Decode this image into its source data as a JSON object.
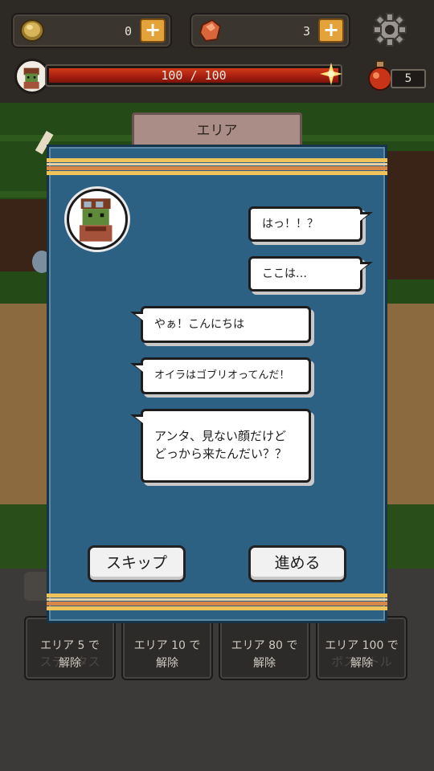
{
  "hud": {
    "coins": {
      "icon": "coin-icon",
      "value": "0"
    },
    "gems": {
      "icon": "gem-icon",
      "value": "3"
    },
    "plus_label": "+",
    "hp": {
      "current_max": "100 / 100",
      "fraction": 1.0
    },
    "potion": {
      "icon": "potion-icon",
      "count": "5"
    }
  },
  "scene": {
    "area_tab_label": "エリア"
  },
  "dialog": {
    "messages": [
      {
        "side": "right",
        "text": "はっ！！？"
      },
      {
        "side": "right",
        "text": "ここは…"
      },
      {
        "side": "left",
        "text": "やぁ！こんにちは"
      },
      {
        "side": "left",
        "text": "オイラはゴブリオってんだ！"
      },
      {
        "side": "left",
        "text_line1": "アンタ、見ない顔だけど",
        "text_line2": "どっから来たんだい？？"
      }
    ],
    "skip_label": "スキップ",
    "next_label": "進める"
  },
  "bottom_buttons": [
    {
      "bg_label": "ステータス",
      "line1": "エリア 5 で",
      "line2": "解除"
    },
    {
      "bg_label": "",
      "line1": "エリア 10 で",
      "line2": "解除"
    },
    {
      "bg_label": "",
      "line1": "エリア 80 で",
      "line2": "解除"
    },
    {
      "bg_label": "ボスバトル",
      "line1": "エリア 100 で",
      "line2": "解除"
    }
  ],
  "colors": {
    "dialog_bg": "#2d6184",
    "band_gold": "#f0c25a",
    "band_orange": "#d8874a",
    "hp_red": "#c22a14",
    "plus_orange": "#e3a23a"
  }
}
